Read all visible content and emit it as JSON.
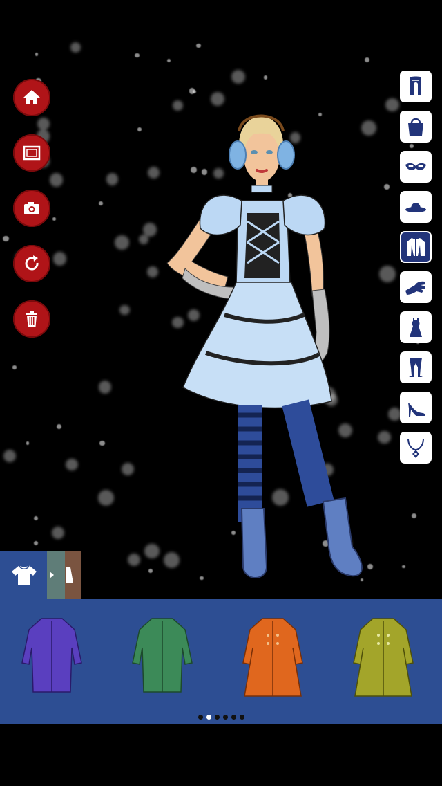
{
  "toolbar_left": [
    {
      "id": "home",
      "icon": "home-icon"
    },
    {
      "id": "frame",
      "icon": "frame-icon"
    },
    {
      "id": "camera",
      "icon": "camera-icon"
    },
    {
      "id": "reset",
      "icon": "redo-icon"
    },
    {
      "id": "delete",
      "icon": "trash-icon"
    }
  ],
  "categories": [
    {
      "id": "scarves",
      "icon": "scarf-icon",
      "active": false
    },
    {
      "id": "bags",
      "icon": "handbag-icon",
      "active": false
    },
    {
      "id": "masks",
      "icon": "mask-icon",
      "active": false
    },
    {
      "id": "hats",
      "icon": "hat-icon",
      "active": false
    },
    {
      "id": "outerwear",
      "icon": "jacket-icon",
      "active": true
    },
    {
      "id": "gloves",
      "icon": "glove-icon",
      "active": false
    },
    {
      "id": "dresses",
      "icon": "dress-icon",
      "active": false
    },
    {
      "id": "tights",
      "icon": "tights-icon",
      "active": false
    },
    {
      "id": "shoes",
      "icon": "heel-icon",
      "active": false
    },
    {
      "id": "jewelry",
      "icon": "necklace-icon",
      "active": false
    }
  ],
  "tabs": [
    {
      "id": "tops",
      "icon": "shirt-icon",
      "color": "#2d4e93"
    },
    {
      "id": "tab-2",
      "color": "#5f7d78"
    },
    {
      "id": "tab-3",
      "color": "#7a5440"
    }
  ],
  "tray_items": [
    {
      "id": "coat-purple",
      "color": "#5a3fbf"
    },
    {
      "id": "coat-green",
      "color": "#3c8a58"
    },
    {
      "id": "coat-orange",
      "color": "#e0671e"
    },
    {
      "id": "coat-olive",
      "color": "#a3a52a"
    }
  ],
  "pagination": {
    "pages": 6,
    "current": 2
  },
  "colors": {
    "accent_red": "#b01418",
    "tray_blue": "#2d4e93",
    "active_category": "#22347a"
  }
}
